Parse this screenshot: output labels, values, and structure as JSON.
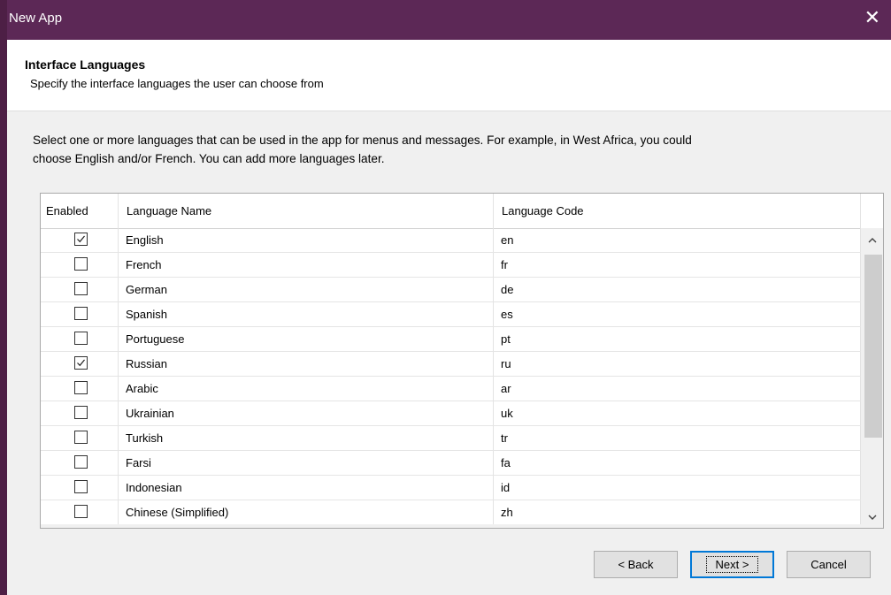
{
  "window": {
    "title": "New App"
  },
  "header": {
    "title": "Interface Languages",
    "subtitle": "Specify the interface languages the user can choose from"
  },
  "intro": {
    "line1": "Select one or more languages that can be used in the app for menus and messages. For example, in West Africa, you could",
    "line2": "choose English and/or French. You can add more languages later."
  },
  "table": {
    "columns": [
      "Enabled",
      "Language Name",
      "Language Code"
    ],
    "rows": [
      {
        "enabled": true,
        "name": "English",
        "code": "en"
      },
      {
        "enabled": false,
        "name": "French",
        "code": "fr"
      },
      {
        "enabled": false,
        "name": "German",
        "code": "de"
      },
      {
        "enabled": false,
        "name": "Spanish",
        "code": "es"
      },
      {
        "enabled": false,
        "name": "Portuguese",
        "code": "pt"
      },
      {
        "enabled": true,
        "name": "Russian",
        "code": "ru"
      },
      {
        "enabled": false,
        "name": "Arabic",
        "code": "ar"
      },
      {
        "enabled": false,
        "name": "Ukrainian",
        "code": "uk"
      },
      {
        "enabled": false,
        "name": "Turkish",
        "code": "tr"
      },
      {
        "enabled": false,
        "name": "Farsi",
        "code": "fa"
      },
      {
        "enabled": false,
        "name": "Indonesian",
        "code": "id"
      },
      {
        "enabled": false,
        "name": "Chinese (Simplified)",
        "code": "zh"
      }
    ]
  },
  "buttons": {
    "back": "< Back",
    "next": "Next >",
    "cancel": "Cancel"
  },
  "icons": {
    "close": "close-icon",
    "scroll_up": "chevron-up-icon",
    "scroll_down": "chevron-down-icon",
    "checkbox": "checkmark-icon"
  },
  "colors": {
    "titlebar": "#5c2856",
    "border_accent": "#4d1f45",
    "default_button_border": "#0078d7"
  }
}
